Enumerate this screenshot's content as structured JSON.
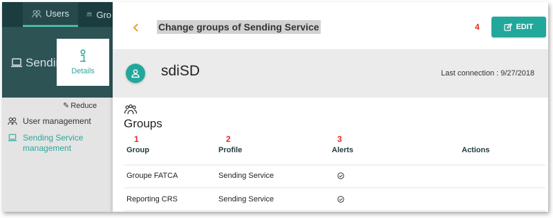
{
  "app": {
    "tabs": [
      {
        "label": "Users",
        "icon": "users-icon"
      },
      {
        "label": "Gro",
        "icon": "groups-icon"
      }
    ],
    "header_title": "Sendin",
    "details_tile_label": "Details",
    "reduce_label": "Reduce",
    "sidebar_items": [
      {
        "label": "User management",
        "icon": "users-icon"
      },
      {
        "label": "Sending Service management",
        "icon": "laptop-icon"
      }
    ]
  },
  "modal": {
    "back_icon": "chevron-left-icon",
    "title": "Change groups of Sending Service",
    "edit_label": "EDIT",
    "edit_icon": "edit-icon",
    "user": {
      "name": "sdiSD",
      "last_connection": "Last connection : 9/27/2018"
    },
    "groups_title": "Groups",
    "annotations": {
      "group": "1",
      "profile": "2",
      "alerts": "3",
      "edit": "4"
    },
    "columns": [
      "Group",
      "Profile",
      "Alerts",
      "Actions"
    ],
    "rows": [
      {
        "group": "Groupe FATCA",
        "profile": "Sending Service",
        "alerts": "check-circle-icon"
      },
      {
        "group": "Reporting CRS",
        "profile": "Sending Service",
        "alerts": "check-circle-icon"
      }
    ]
  },
  "colors": {
    "accent": "#21a89b",
    "back_chevron": "#e8a23a",
    "annotation": "#e8261e",
    "topbar": "#1c3d3f",
    "header": "#2e5355"
  }
}
